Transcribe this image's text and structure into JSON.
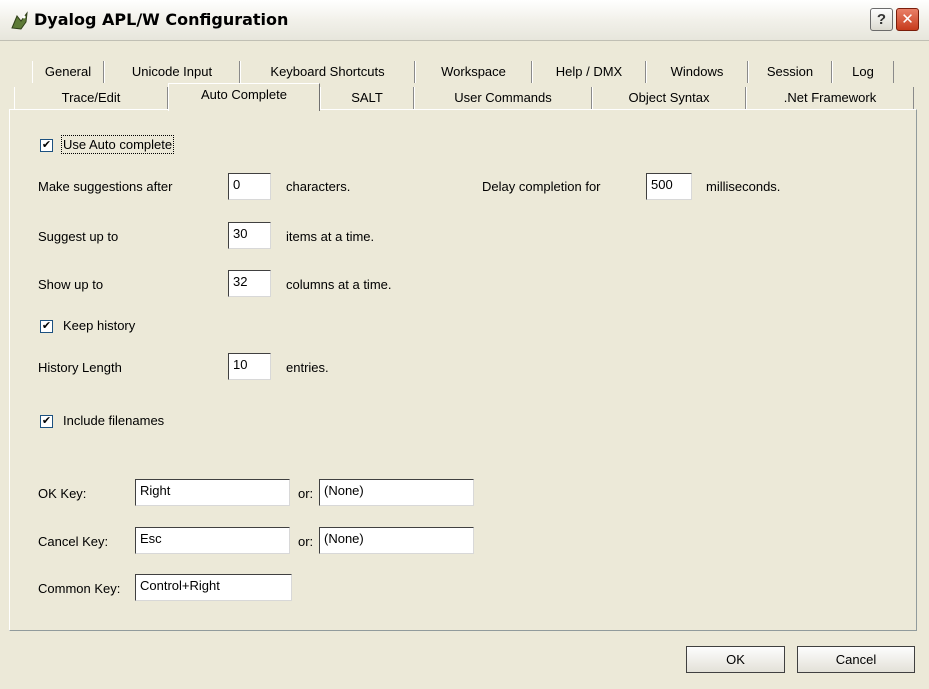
{
  "window": {
    "title": "Dyalog APL/W Configuration",
    "help_glyph": "?",
    "close_glyph": "✕",
    "app_icon": "dyalog-bird-icon"
  },
  "tabs_row1": [
    "General",
    "Unicode Input",
    "Keyboard Shortcuts",
    "Workspace",
    "Help / DMX",
    "Windows",
    "Session",
    "Log"
  ],
  "tabs_row2": [
    "Trace/Edit",
    "Auto Complete",
    "SALT",
    "User Commands",
    "Object Syntax",
    ".Net Framework"
  ],
  "active_tab": "Auto Complete",
  "form": {
    "use_autocomplete": {
      "label": "Use Auto complete",
      "checked": true,
      "mark": "✔"
    },
    "suggest_after": {
      "label": "Make suggestions after",
      "value": "0",
      "unit": "characters."
    },
    "delay": {
      "label": "Delay completion for",
      "value": "500",
      "unit": "milliseconds."
    },
    "suggest_up_to": {
      "label": "Suggest up to",
      "value": "30",
      "unit": "items at a time."
    },
    "show_up_to": {
      "label": "Show up to",
      "value": "32",
      "unit": "columns at a time."
    },
    "keep_history": {
      "label": "Keep history",
      "checked": true,
      "mark": "✔"
    },
    "history_length": {
      "label": "History Length",
      "value": "10",
      "unit": "entries."
    },
    "include_filenames": {
      "label": "Include filenames",
      "checked": true,
      "mark": "✔"
    },
    "ok_key": {
      "label": "OK Key:",
      "value": "Right",
      "or_label": "or:",
      "alt_value": "(None)"
    },
    "cancel_key": {
      "label": "Cancel Key:",
      "value": "Esc",
      "or_label": "or:",
      "alt_value": "(None)"
    },
    "common_key": {
      "label": "Common Key:",
      "value": "Control+Right"
    }
  },
  "buttons": {
    "ok": "OK",
    "cancel": "Cancel"
  },
  "colors": {
    "face": "#ece9d8",
    "close": "#c63b1c",
    "title_bg": "#f2f1ea"
  }
}
